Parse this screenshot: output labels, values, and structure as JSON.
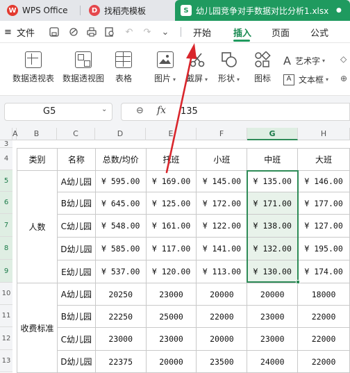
{
  "tabs": {
    "wps": "WPS Office",
    "template": "找稻壳模板",
    "file": "幼儿园竞争对手数据对比分析1.xlsx",
    "file_icon": "S",
    "dot": "●"
  },
  "menu": {
    "file": "文件",
    "start": "开始",
    "insert": "插入",
    "page": "页面",
    "formula": "公式"
  },
  "ribbon": {
    "pivot_table": "数据透视表",
    "pivot_chart": "数据透视图",
    "table": "表格",
    "picture": "图片",
    "screenshot": "截屏",
    "shape": "形状",
    "icon": "图标",
    "wordart": "艺术字",
    "textbox": "文本框"
  },
  "formula_bar": {
    "cell_ref": "G5",
    "fx": "fx",
    "value": "135"
  },
  "columns": [
    "A",
    "B",
    "C",
    "D",
    "E",
    "F",
    "G",
    "H"
  ],
  "rows": [
    "3",
    "4",
    "5",
    "6",
    "7",
    "8",
    "9",
    "10",
    "11",
    "12",
    "13"
  ],
  "table": {
    "headers": [
      "类别",
      "名称",
      "总数/均价",
      "托班",
      "小班",
      "中班",
      "大班"
    ],
    "group1": "人数",
    "group2": "收费标准",
    "rows1": [
      {
        "name": "A幼儿园",
        "vals": [
          "¥ 595.00",
          "¥ 169.00",
          "¥ 145.00",
          "¥ 135.00",
          "¥ 146.00"
        ]
      },
      {
        "name": "B幼儿园",
        "vals": [
          "¥ 645.00",
          "¥ 125.00",
          "¥ 172.00",
          "¥ 171.00",
          "¥ 177.00"
        ]
      },
      {
        "name": "C幼儿园",
        "vals": [
          "¥ 548.00",
          "¥ 161.00",
          "¥ 122.00",
          "¥ 138.00",
          "¥ 127.00"
        ]
      },
      {
        "name": "D幼儿园",
        "vals": [
          "¥ 585.00",
          "¥ 117.00",
          "¥ 141.00",
          "¥ 132.00",
          "¥ 195.00"
        ]
      },
      {
        "name": "E幼儿园",
        "vals": [
          "¥ 537.00",
          "¥ 120.00",
          "¥ 113.00",
          "¥ 130.00",
          "¥ 174.00"
        ]
      }
    ],
    "rows2": [
      {
        "name": "A幼儿园",
        "vals": [
          "20250",
          "23000",
          "20000",
          "20000",
          "18000"
        ]
      },
      {
        "name": "B幼儿园",
        "vals": [
          "22250",
          "25000",
          "22000",
          "23000",
          "22000"
        ]
      },
      {
        "name": "C幼儿园",
        "vals": [
          "23000",
          "23000",
          "20000",
          "23000",
          "22000"
        ]
      },
      {
        "name": "D幼儿园",
        "vals": [
          "22375",
          "20000",
          "23500",
          "24000",
          "22000"
        ]
      }
    ]
  },
  "colors": {
    "accent": "#1f9a5f",
    "selection": "#2e8b57",
    "arrow": "#d9262c"
  }
}
